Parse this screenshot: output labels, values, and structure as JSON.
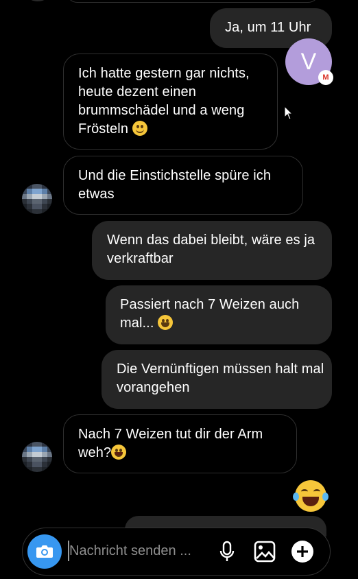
{
  "messages": {
    "m1": "Ja, um 11 Uhr",
    "m2": "Ich hatte gestern gar nichts, heute dezent einen brummschädel und a weng Frösteln",
    "m3": "Und die Einstichstelle spüre ich etwas",
    "m4": "Wenn das dabei bleibt, wäre es ja verkraftbar",
    "m5": "Passiert nach 7 Weizen auch mal...",
    "m6": "Die Vernünftigen müssen halt mal vorangehen",
    "m7": "Nach 7 Weizen tut dir der Arm weh?"
  },
  "floating_avatar": {
    "letter": "V",
    "color": "#b39ddb",
    "badge": "M"
  },
  "composer": {
    "placeholder": "Nachricht senden ...",
    "icons": [
      "camera-icon",
      "microphone-icon",
      "gallery-icon",
      "add-icon"
    ]
  },
  "colors": {
    "accent": "#3797f0",
    "bubble_out": "#262626",
    "background": "#000000"
  }
}
